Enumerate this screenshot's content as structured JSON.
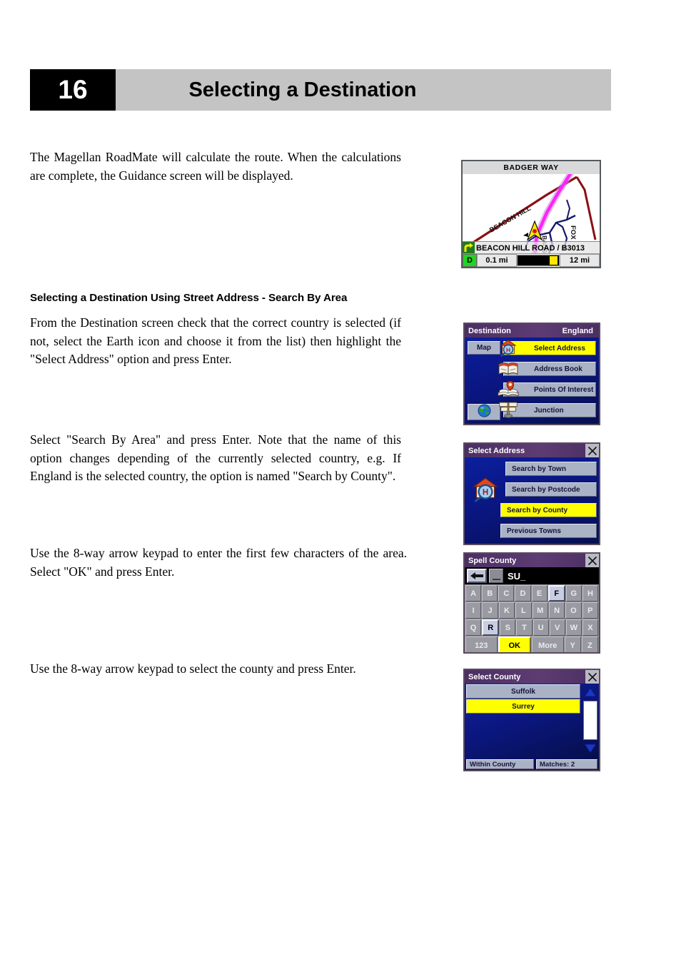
{
  "header": {
    "chapter_number": "16",
    "title": "Selecting a Destination"
  },
  "content": {
    "para1": "The Magellan RoadMate will calculate the route. When the calculations are complete, the Guidance screen will be displayed.",
    "subheading": "Selecting a Destination Using Street Address - Search By Area",
    "para2": "From the Destination screen check that the correct country is selected (if not, select the Earth icon and choose it from the list) then highlight the \"Select Address\" option and press Enter.",
    "para3": "Select \"Search By Area\" and press Enter. Note that the name of this option changes depending of the currently selected country, e.g. If England is the selected country, the option is named \"Search by County\".",
    "para4": "Use the 8-way arrow keypad to enter the first few characters of the area. Select \"OK\" and press Enter.",
    "para5": "Use the 8-way arrow keypad to select the county and press Enter."
  },
  "screenshots": {
    "guidance_map": {
      "banner_label": "BADGER WAY",
      "street_labels": [
        "BEACON HILL",
        "FOX",
        "BADGER"
      ],
      "current_street": "BEACON HILL ROAD / B3013",
      "turn_icon": "turn-right-icon",
      "status": {
        "mode_letter": "D",
        "distance_next": "0.1 mi",
        "distance_total": "12 mi",
        "progress_percent": 88
      },
      "colors": {
        "route": "#ff22ff",
        "highway": "#8b0f14",
        "road": "#17176e",
        "turn_badge": "#1d7a1d",
        "mode_badge": "#22d422"
      }
    },
    "destination_menu": {
      "title": "Destination",
      "country": "England",
      "map_button": "Map",
      "globe_icon": "earth-globe-icon",
      "items": [
        {
          "label": "Select Address",
          "icon": "house-magnifier-icon",
          "highlighted": true
        },
        {
          "label": "Address Book",
          "icon": "address-book-icon",
          "highlighted": false
        },
        {
          "label": "Points Of Interest",
          "icon": "points-of-interest-icon",
          "highlighted": false
        },
        {
          "label": "Junction",
          "icon": "junction-signpost-icon",
          "highlighted": false
        }
      ]
    },
    "select_address": {
      "title": "Select Address",
      "close_icon": "close-icon",
      "icon": "house-magnifier-icon",
      "items": [
        {
          "label": "Search by Town",
          "highlighted": false
        },
        {
          "label": "Search by Postcode",
          "highlighted": false
        },
        {
          "label": "Search by County",
          "highlighted": true
        },
        {
          "label": "Previous Towns",
          "highlighted": false
        }
      ]
    },
    "spell_county": {
      "title": "Spell County",
      "close_icon": "close-icon",
      "back_icon": "backspace-arrow-icon",
      "space_icon": "space-bar-icon",
      "entry_text": "SU_",
      "keyboard_rows": [
        [
          {
            "label": "A",
            "state": "normal"
          },
          {
            "label": "B",
            "state": "normal"
          },
          {
            "label": "C",
            "state": "normal"
          },
          {
            "label": "D",
            "state": "normal"
          },
          {
            "label": "E",
            "state": "normal"
          },
          {
            "label": "F",
            "state": "active"
          },
          {
            "label": "G",
            "state": "normal"
          },
          {
            "label": "H",
            "state": "normal"
          }
        ],
        [
          {
            "label": "I",
            "state": "normal"
          },
          {
            "label": "J",
            "state": "normal"
          },
          {
            "label": "K",
            "state": "normal"
          },
          {
            "label": "L",
            "state": "normal"
          },
          {
            "label": "M",
            "state": "normal"
          },
          {
            "label": "N",
            "state": "normal"
          },
          {
            "label": "O",
            "state": "normal"
          },
          {
            "label": "P",
            "state": "normal"
          }
        ],
        [
          {
            "label": "Q",
            "state": "normal"
          },
          {
            "label": "R",
            "state": "active"
          },
          {
            "label": "S",
            "state": "normal"
          },
          {
            "label": "T",
            "state": "normal"
          },
          {
            "label": "U",
            "state": "normal"
          },
          {
            "label": "V",
            "state": "normal"
          },
          {
            "label": "W",
            "state": "normal"
          },
          {
            "label": "X",
            "state": "normal"
          }
        ],
        [
          {
            "label": "123",
            "state": "normal",
            "wide": true
          },
          {
            "label": "OK",
            "state": "ok",
            "wide": true
          },
          {
            "label": "More",
            "state": "normal",
            "wide": true
          },
          {
            "label": "Y",
            "state": "normal"
          },
          {
            "label": "Z",
            "state": "normal"
          }
        ]
      ]
    },
    "select_county": {
      "title": "Select County",
      "close_icon": "close-icon",
      "scroll_up_icon": "triangle-up-icon",
      "scroll_down_icon": "triangle-down-icon",
      "items": [
        {
          "label": "Suffolk",
          "highlighted": false
        },
        {
          "label": "Surrey",
          "highlighted": true
        }
      ],
      "status_left": "Within County",
      "status_right": "Matches: 2"
    }
  }
}
